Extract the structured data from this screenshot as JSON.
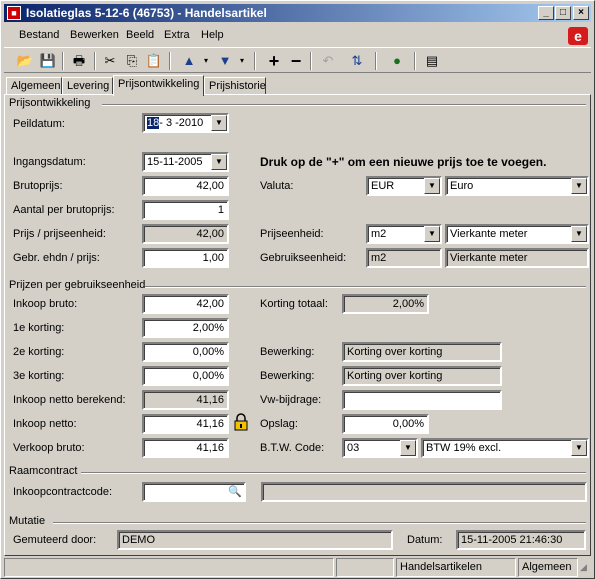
{
  "window": {
    "title": "Isolatieglas 5-12-6 (46753) - Handelsartikel"
  },
  "menu": [
    "Bestand",
    "Bewerken",
    "Beeld",
    "Extra",
    "Help"
  ],
  "tabs": [
    "Algemeen",
    "Levering",
    "Prijsontwikkeling",
    "Prijshistorie"
  ],
  "prijsontwikkeling": {
    "heading": "Prijsontwikkeling",
    "peildatum_label": "Peildatum:",
    "peildatum_sel": "18",
    "peildatum_rest": "- 3 -2010"
  },
  "prices": {
    "ingangsdatum_label": "Ingangsdatum:",
    "ingangsdatum": "15-11-2005",
    "hint": "Druk op de \"+\" om een nieuwe prijs toe te voegen.",
    "brutoprijs_label": "Brutoprijs:",
    "brutoprijs": "42,00",
    "valuta_label": "Valuta:",
    "valuta_code": "EUR",
    "valuta_name": "Euro",
    "aantal_label": "Aantal per brutoprijs:",
    "aantal": "1",
    "prijs_eenheid_label": "Prijs / prijseenheid:",
    "prijs_eenheid": "42,00",
    "prijseenheid_label": "Prijseenheid:",
    "prijseenheid_code": "m2",
    "prijseenheid_name": "Vierkante meter",
    "gebr_label": "Gebr. ehdn / prijs:",
    "gebr": "1,00",
    "gebruikseenheid_label": "Gebruikseenheid:",
    "gebruikseenheid_code": "m2",
    "gebruikseenheid_name": "Vierkante meter"
  },
  "gebruik": {
    "heading": "Prijzen per gebruikseenheid",
    "inkoop_bruto_label": "Inkoop bruto:",
    "inkoop_bruto": "42,00",
    "korting_totaal_label": "Korting totaal:",
    "korting_totaal": "2,00%",
    "k1_label": "1e korting:",
    "k1": "2,00%",
    "k2_label": "2e korting:",
    "k2": "0,00%",
    "bewerking_label": "Bewerking:",
    "bewerking2": "Korting over korting",
    "k3_label": "3e korting:",
    "k3": "0,00%",
    "bewerking3": "Korting over korting",
    "netto_berekend_label": "Inkoop netto berekend:",
    "netto_berekend": "41,16",
    "vw_label": "Vw-bijdrage:",
    "vw": "",
    "netto_label": "Inkoop netto:",
    "netto": "41,16",
    "opslag_label": "Opslag:",
    "opslag": "0,00%",
    "verkoop_label": "Verkoop bruto:",
    "verkoop": "41,16",
    "btw_label": "B.T.W. Code:",
    "btw_code": "03",
    "btw_name": "BTW 19% excl."
  },
  "raamcontract": {
    "heading": "Raamcontract",
    "code_label": "Inkoopcontractcode:",
    "code": "",
    "desc": ""
  },
  "mutatie": {
    "heading": "Mutatie",
    "door_label": "Gemuteerd door:",
    "door": "DEMO",
    "datum_label": "Datum:",
    "datum": "15-11-2005 21:46:30"
  },
  "status": {
    "p1": "",
    "p2": "",
    "p3": "Handelsartikelen",
    "p4": "Algemeen"
  }
}
